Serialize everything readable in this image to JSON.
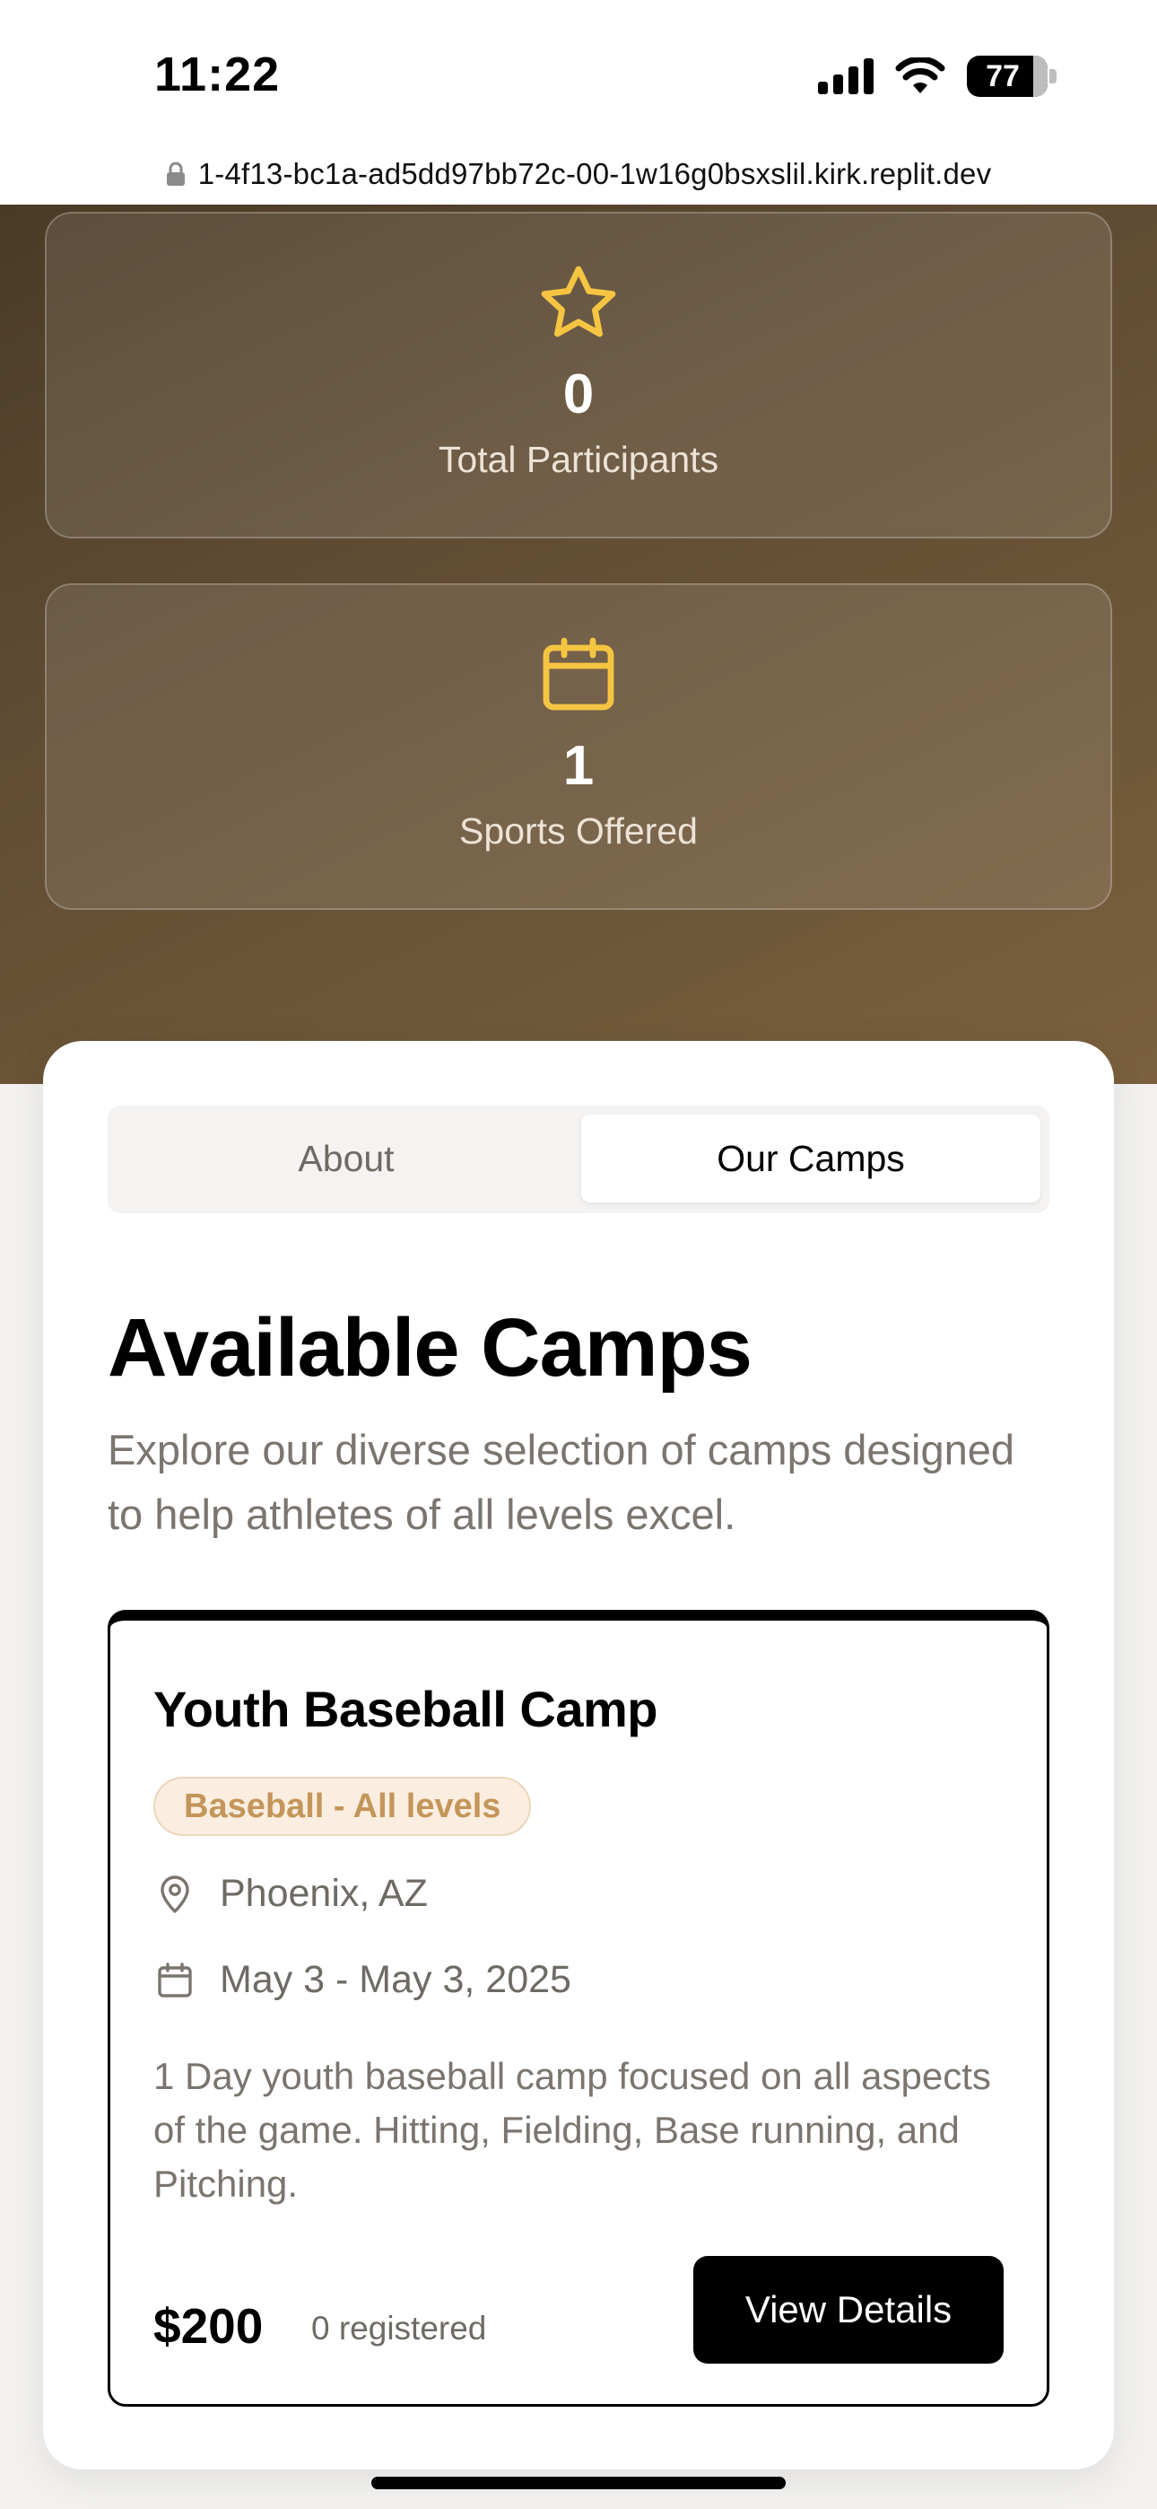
{
  "status_bar": {
    "time": "11:22",
    "battery": "77"
  },
  "browser": {
    "url": "1-4f13-bc1a-ad5dd97bb72c-00-1w16g0bsxslil.kirk.replit.dev"
  },
  "stats": [
    {
      "icon": "star-icon",
      "value": "0",
      "label": "Total Participants"
    },
    {
      "icon": "calendar-icon",
      "value": "1",
      "label": "Sports Offered"
    }
  ],
  "tabs": {
    "about": "About",
    "camps": "Our Camps",
    "active": "camps"
  },
  "section": {
    "title": "Available Camps",
    "subtitle": "Explore our diverse selection of camps designed to help athletes of all levels excel."
  },
  "camp": {
    "title": "Youth Baseball Camp",
    "badge": "Baseball - All levels",
    "location": "Phoenix, AZ",
    "dates": "May 3 - May 3, 2025",
    "description": "1 Day youth baseball camp focused on all aspects of the game. Hitting, Fielding, Base running, and Pitching.",
    "price": "$200",
    "registered": "0 registered",
    "button": "View Details"
  },
  "colors": {
    "accent": "#f5c542",
    "hero_dark": "#4a3a25",
    "hero_light": "#7a603e",
    "badge_text": "#c4955a"
  }
}
